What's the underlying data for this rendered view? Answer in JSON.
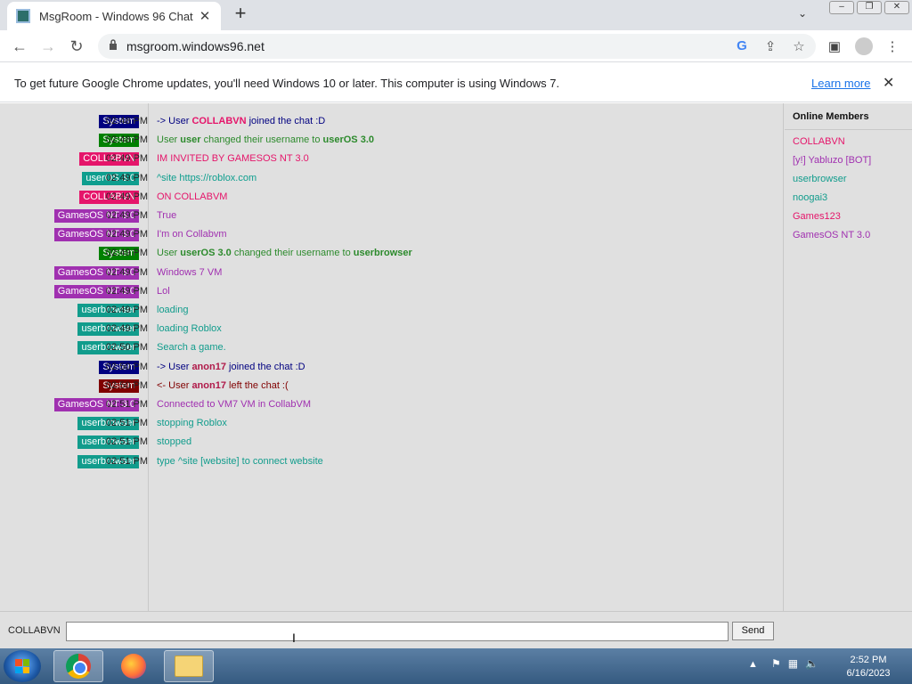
{
  "browser": {
    "tab_title": "MsgRoom - Windows 96 Chat",
    "url": "msgroom.windows96.net",
    "infobar_message": "To get future Google Chrome updates, you'll need Windows 10 or later. This computer is using Windows 7.",
    "infobar_link": "Learn more"
  },
  "colors": {
    "system_blue": "#000080",
    "system_green": "#008000",
    "system_red": "#800000",
    "collabvn": "#e5156a",
    "useros": "#0e9e8e",
    "gamesos": "#a030b0",
    "userbrowser": "#119c8c"
  },
  "chat": {
    "messages": [
      {
        "time": "02:48 PM",
        "user": "System",
        "color": "#000080",
        "text_color": "#000080",
        "pre": "-> User ",
        "name": "COLLABVN",
        "name_color": "#e5156a",
        "post": " joined the chat :D"
      },
      {
        "time": "02:48 PM",
        "user": "System",
        "color": "#008000",
        "text_color": "#2c8a2c",
        "pre": "User ",
        "name": "user",
        "name_color": "#2c8a2c",
        "mid": " changed their username to ",
        "name2": "userOS 3.0",
        "name2_color": "#2c8a2c"
      },
      {
        "time": "02:49 PM",
        "user": "COLLABVN",
        "color": "#e5156a",
        "text_color": "#e5156a",
        "pre": "IM INVITED BY GAMESOS NT 3.0"
      },
      {
        "time": "02:49 PM",
        "user": "userOS 3.0",
        "color": "#0e9e8e",
        "text_color": "#0e9e8e",
        "pre": "^site https://roblox.com"
      },
      {
        "time": "02:49 PM",
        "user": "COLLABVN",
        "color": "#e5156a",
        "text_color": "#e5156a",
        "pre": "ON COLLABVM"
      },
      {
        "time": "02:49 PM",
        "user": "GamesOS NT 3.0",
        "color": "#a030b0",
        "text_color": "#a030b0",
        "pre": "True"
      },
      {
        "time": "02:49 PM",
        "user": "GamesOS NT 3.0",
        "color": "#a030b0",
        "text_color": "#a030b0",
        "pre": "I'm on Collabvm"
      },
      {
        "time": "02:49 PM",
        "user": "System",
        "color": "#008000",
        "text_color": "#2c8a2c",
        "pre": "User ",
        "name": "userOS 3.0",
        "name_color": "#2c8a2c",
        "mid": " changed their username to ",
        "name2": "userbrowser",
        "name2_color": "#2c8a2c"
      },
      {
        "time": "02:49 PM",
        "user": "GamesOS NT 3.0",
        "color": "#a030b0",
        "text_color": "#a030b0",
        "pre": "Windows 7 VM"
      },
      {
        "time": "02:49 PM",
        "user": "GamesOS NT 3.0",
        "color": "#a030b0",
        "text_color": "#a030b0",
        "pre": "Lol"
      },
      {
        "time": "02:49 PM",
        "user": "userbrowser",
        "color": "#119c8c",
        "text_color": "#119c8c",
        "pre": "loading"
      },
      {
        "time": "02:49 PM",
        "user": "userbrowser",
        "color": "#119c8c",
        "text_color": "#119c8c",
        "pre": "loading Roblox"
      },
      {
        "time": "02:50 PM",
        "user": "userbrowser",
        "color": "#119c8c",
        "text_color": "#119c8c",
        "pre": "Search a game."
      },
      {
        "time": "02:50 PM",
        "user": "System",
        "color": "#000080",
        "text_color": "#000080",
        "pre": "-> User ",
        "name": "anon17",
        "name_color": "#b01a4a",
        "post": " joined the chat :D"
      },
      {
        "time": "02:50 PM",
        "user": "System",
        "color": "#800000",
        "text_color": "#800000",
        "pre": "<- User ",
        "name": "anon17",
        "name_color": "#b01a4a",
        "post": " left the chat :("
      },
      {
        "time": "02:51 PM",
        "user": "GamesOS NT 3.0",
        "color": "#a030b0",
        "text_color": "#a030b0",
        "pre": "Connected to VM7 VM in CollabVM"
      },
      {
        "time": "02:51 PM",
        "user": "userbrowser",
        "color": "#119c8c",
        "text_color": "#119c8c",
        "pre": "stopping Roblox"
      },
      {
        "time": "02:51 PM",
        "user": "userbrowser",
        "color": "#119c8c",
        "text_color": "#119c8c",
        "pre": "stopped"
      },
      {
        "time": "02:51 PM",
        "user": "userbrowser",
        "color": "#119c8c",
        "text_color": "#119c8c",
        "pre": "type ^site [website] to connect website"
      }
    ]
  },
  "members": {
    "title": "Online Members",
    "list": [
      {
        "name": "COLLABVN",
        "color": "#e5156a"
      },
      {
        "name": "[y!] Yabluzo [BOT]",
        "color": "#a030b0"
      },
      {
        "name": "userbrowser",
        "color": "#119c8c"
      },
      {
        "name": "noogai3",
        "color": "#119c8c"
      },
      {
        "name": "Games123",
        "color": "#e5156a"
      },
      {
        "name": "GamesOS NT 3.0",
        "color": "#a030b0"
      }
    ]
  },
  "composer": {
    "nickname": "COLLABVN",
    "input_value": "",
    "send_label": "Send"
  },
  "taskbar": {
    "time": "2:52 PM",
    "date": "6/16/2023"
  }
}
